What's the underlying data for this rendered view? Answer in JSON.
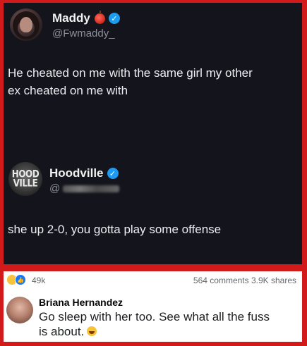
{
  "tweet1": {
    "name": "Maddy",
    "handle": "@Fwmaddy_",
    "text_line1": "He cheated on me with the same girl my other",
    "text_line2": "ex cheated on me with",
    "icons": [
      "apple-emoji",
      "verified-badge-icon"
    ]
  },
  "tweet2": {
    "name": "Hoodville",
    "handle_prefix": "@",
    "logo_text_line1": "HOOD",
    "logo_text_line2": "VILLE",
    "text": "she up 2-0, you gotta play some offense",
    "icons": [
      "verified-badge-icon"
    ]
  },
  "facebook": {
    "reactions_count": "49k",
    "comments_shares": "564 comments  3.9K shares",
    "comment": {
      "author": "Briana Hernandez",
      "line1": "Go sleep with her too. See what all the fuss",
      "line2": "is about."
    }
  },
  "colors": {
    "border": "#d31a1a",
    "tweet_bg": "#14141d",
    "verified": "#1d9bf0",
    "fb_blue": "#1877f2"
  }
}
